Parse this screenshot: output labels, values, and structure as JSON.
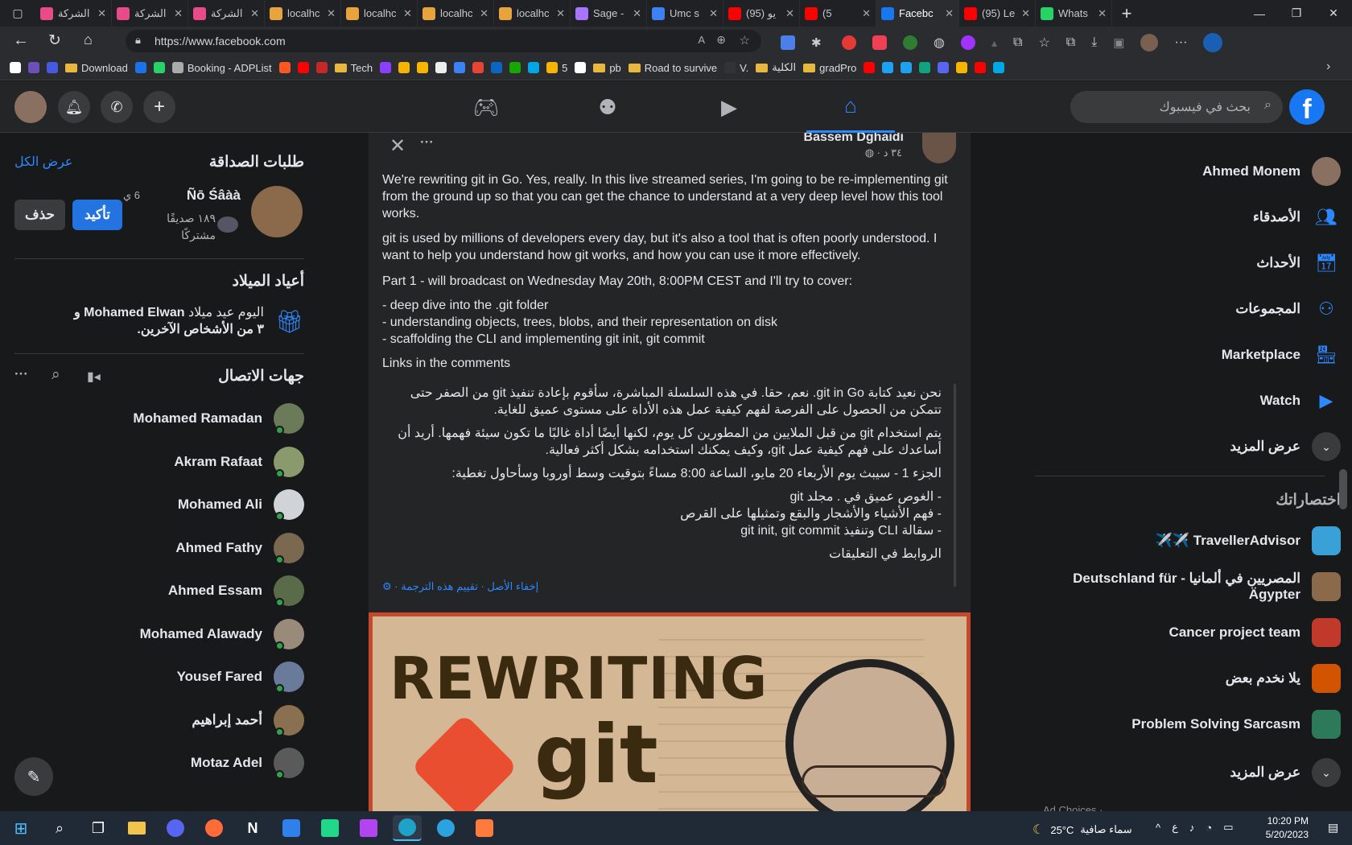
{
  "browser": {
    "tabs": [
      {
        "title": "الشركة",
        "color": "#e94b8a"
      },
      {
        "title": "الشركة",
        "color": "#e94b8a"
      },
      {
        "title": "الشركة",
        "color": "#e94b8a"
      },
      {
        "title": "localhc",
        "color": "#e8a33d"
      },
      {
        "title": "localhc",
        "color": "#e8a33d"
      },
      {
        "title": "localhc",
        "color": "#e8a33d"
      },
      {
        "title": "localhc",
        "color": "#e8a33d"
      },
      {
        "title": "Sage -",
        "color": "#a974ff"
      },
      {
        "title": "Umc s",
        "color": "#3b82f6"
      },
      {
        "title": "(95) يو",
        "color": "#ff0000"
      },
      {
        "title": "(5",
        "color": "#ff0000"
      },
      {
        "title": "Facebc",
        "color": "#1877f2",
        "active": true
      },
      {
        "title": "(95) Le",
        "color": "#ff0000"
      },
      {
        "title": "Whats",
        "color": "#25d366"
      }
    ],
    "new_tab": "+",
    "url": "https://www.facebook.com",
    "bookmarks": [
      {
        "label": "",
        "color": "#fff"
      },
      {
        "label": "",
        "color": "#6b4fbb"
      },
      {
        "label": "",
        "color": "#4659e0"
      },
      {
        "label": "Download",
        "folder": true
      },
      {
        "label": "",
        "color": "#1a73e8"
      },
      {
        "label": "",
        "color": "#25d366"
      },
      {
        "label": "Booking - ADPList",
        "color": "#aaa"
      },
      {
        "label": "",
        "color": "#ff5722"
      },
      {
        "label": "",
        "color": "#ff0000"
      },
      {
        "label": "",
        "color": "#c62828"
      },
      {
        "label": "Tech",
        "folder": true
      },
      {
        "label": "",
        "color": "#8a3ffc"
      },
      {
        "label": "",
        "color": "#f7b500"
      },
      {
        "label": "",
        "color": "#f7b500"
      },
      {
        "label": "",
        "color": "#eee"
      },
      {
        "label": "",
        "color": "#3b82f6"
      },
      {
        "label": "",
        "color": "#ea4335"
      },
      {
        "label": "",
        "color": "#0a66c2"
      },
      {
        "label": "",
        "color": "#14a800"
      },
      {
        "label": "",
        "color": "#00a8e8"
      },
      {
        "label": "5",
        "color": "#f7b500"
      },
      {
        "label": "",
        "color": "#fff"
      },
      {
        "label": "pb",
        "folder": true
      },
      {
        "label": "Road to survive",
        "folder": true
      },
      {
        "label": "V.",
        "color": "#333"
      },
      {
        "label": "الكلية",
        "folder": true
      },
      {
        "label": "gradPro",
        "folder": true
      },
      {
        "label": "",
        "color": "#ff0000"
      },
      {
        "label": "",
        "color": "#1da1f2"
      },
      {
        "label": "",
        "color": "#1da1f2"
      },
      {
        "label": "",
        "color": "#10a37f"
      },
      {
        "label": "",
        "color": "#5865f2"
      },
      {
        "label": "",
        "color": "#f7b500"
      },
      {
        "label": "",
        "color": "#ff0000"
      },
      {
        "label": "",
        "color": "#00a8e8"
      }
    ]
  },
  "fb": {
    "search_placeholder": "بحث في فيسبوك",
    "logo": "f",
    "left": {
      "friend_requests_title": "طلبات الصداقة",
      "see_all": "عرض الكل",
      "request_name": "Ñō Śâàà",
      "request_time": "6 ي",
      "mutual": "١٨٩ صديقًا مشتركًا",
      "confirm": "تأكيد",
      "delete": "حذف",
      "birthdays_title": "أعياد الميلاد",
      "birthday_text_pre": "اليوم عيد ميلاد ",
      "birthday_name": "Mohamed Elwan",
      "birthday_text_post": " و ٣ من الأشخاص الآخرين.",
      "contacts_title": "جهات الاتصال",
      "contacts": [
        {
          "name": "Mohamed Ramadan",
          "color": "#6b7b5a"
        },
        {
          "name": "Akram Rafaat",
          "color": "#8a9a6c"
        },
        {
          "name": "Mohamed Ali",
          "color": "#d0d3d8"
        },
        {
          "name": "Ahmed Fathy",
          "color": "#7a6850"
        },
        {
          "name": "Ahmed Essam",
          "color": "#5a6b4a"
        },
        {
          "name": "Mohamed Alawady",
          "color": "#9a8a7a"
        },
        {
          "name": "Yousef Fared",
          "color": "#6a7a9a"
        },
        {
          "name": "أحمد إبراهيم",
          "color": "#8a7050"
        },
        {
          "name": "Motaz Adel",
          "color": "#5a5a5a"
        }
      ]
    },
    "post": {
      "author": "Bassem Dghaidi",
      "time": "٣٤ د",
      "p1": "We're rewriting git in Go. Yes, really. In this live streamed series, I'm going to be re-implementing git from the ground up so that you can get the chance to understand at a very deep level how this tool works.",
      "p2": "git is used by millions of developers every day, but it's also a tool that is often poorly understood. I want to help you understand how git works, and how you can use it more effectively.",
      "p3": "Part 1 - will broadcast on Wednesday May 20th, 8:00PM CEST and I'll try to cover:",
      "b1": "- deep dive into the .git folder",
      "b2": "- understanding objects, trees, blobs, and their representation on disk",
      "b3": "- scaffolding the CLI and implementing git init, git commit",
      "p4": "Links in the comments",
      "t1": "نحن نعيد كتابة git in Go. نعم، حقا. في هذه السلسلة المباشرة، سأقوم بإعادة تنفيذ git من الصفر حتى تتمكن من الحصول على الفرصة لفهم كيفية عمل هذه الأداة على مستوى عميق للغاية.",
      "t2": "يتم استخدام git من قبل الملايين من المطورين كل يوم، لكنها أيضًا أداة غالبًا ما تكون سيئة فهمها. أريد أن أساعدك على فهم كيفية عمل git، وكيف يمكنك استخدامه بشكل أكثر فعالية.",
      "t3": "الجزء 1 - سيبث يوم الأربعاء 20 مايو، الساعة 8:00 مساءً بتوقيت وسط أوروبا وسأحاول تغطية:",
      "t4": "- الغوص عميق في . مجلد git",
      "t5": "- فهم الأشياء والأشجار والبقع وتمثيلها على القرص",
      "t6": "- سقالة CLI وتنفيذ git init, git commit",
      "t7": "الروابط في التعليقات",
      "translate_links": "إخفاء الأصل · تقييم هذه الترجمة ·",
      "image_title": "REWRITING",
      "image_sub": "git"
    },
    "right": {
      "profile_name": "Ahmed Monem",
      "nav": [
        {
          "label": "الأصدقاء",
          "color": "#2d88ff"
        },
        {
          "label": "الأحداث",
          "color": "#2d88ff"
        },
        {
          "label": "المجموعات",
          "color": "#2d88ff"
        },
        {
          "label": "Marketplace",
          "color": "#2d88ff"
        },
        {
          "label": "Watch",
          "color": "#2d88ff"
        }
      ],
      "see_more": "عرض المزيد",
      "shortcuts_title": "اختصاراتك",
      "shortcuts": [
        {
          "label": "TravellerAdvisor ✈️✈️",
          "color": "#3aa0d8"
        },
        {
          "label": "المصريين في ألمانيا - Deutschland für Ägypter",
          "color": "#8a6a4a"
        },
        {
          "label": "Cancer project team",
          "color": "#c0392b"
        },
        {
          "label": "يلا نخدم بعض",
          "color": "#d35400"
        },
        {
          "label": "Problem Solving Sarcasm",
          "color": "#2c7a5a"
        }
      ],
      "see_more2": "عرض المزيد",
      "footer": "Ad Choices · ..."
    }
  },
  "taskbar": {
    "weather": "25°C",
    "weather_text": "سماء صافية",
    "lang": "ع",
    "time": "10:20 PM",
    "date": "5/20/2023"
  }
}
